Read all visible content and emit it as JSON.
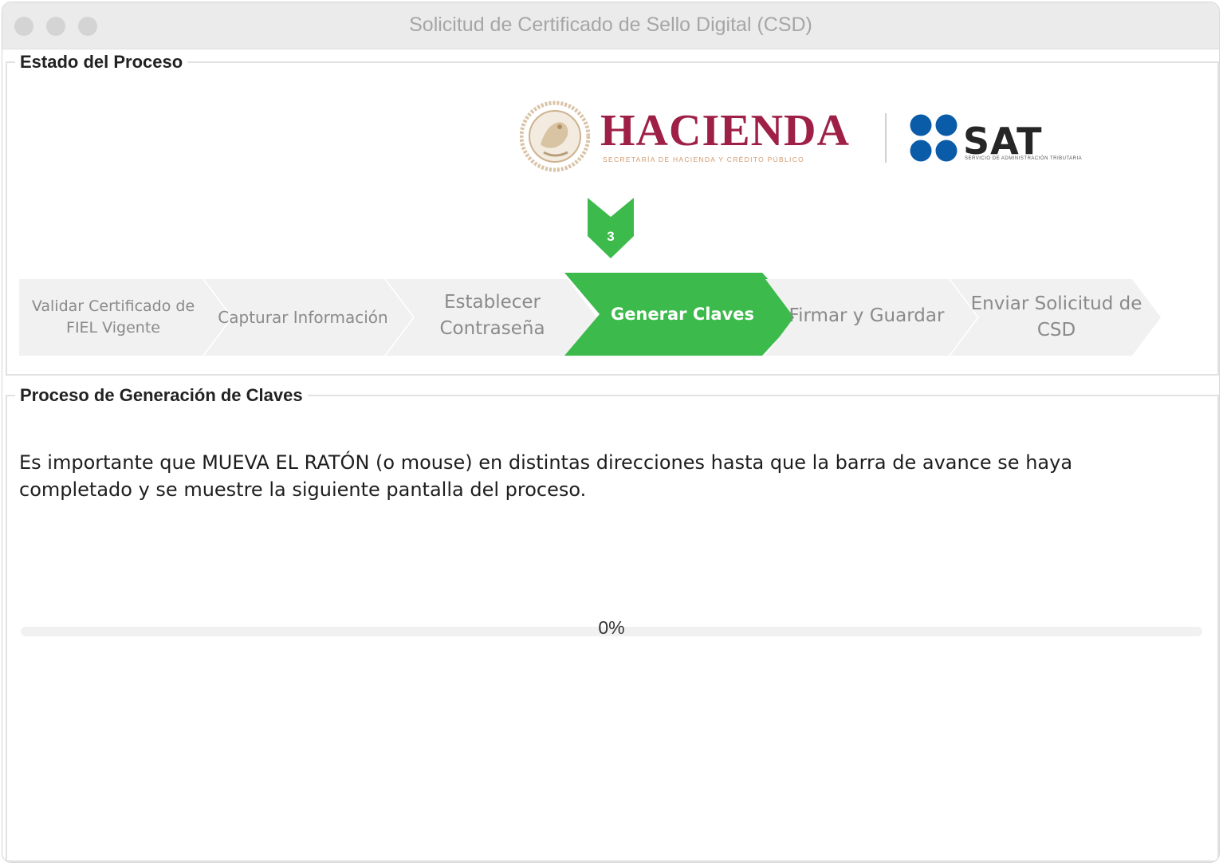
{
  "window": {
    "title": "Solicitud de Certificado de Sello Digital (CSD)"
  },
  "status_panel": {
    "legend": "Estado del Proceso",
    "logos": {
      "hacienda_name": "HACIENDA",
      "hacienda_subtitle": "SECRETARÍA DE HACIENDA Y CRÉDITO PÚBLICO",
      "sat_name": "SAT",
      "sat_subtitle": "SERVICIO DE ADMINISTRACIÓN TRIBUTARIA",
      "hacienda_color": "#9e2046",
      "sat_color": "#0a5ca8"
    },
    "current_step_number": "3",
    "steps": [
      {
        "label": "Validar Certificado de FIEL Vigente",
        "active": false
      },
      {
        "label": "Capturar Información",
        "active": false
      },
      {
        "label": "Establecer Contraseña",
        "active": false
      },
      {
        "label": "Generar Claves",
        "active": true
      },
      {
        "label": "Firmar y Guardar",
        "active": false
      },
      {
        "label": "Enviar Solicitud de CSD",
        "active": false
      }
    ],
    "colors": {
      "active_step": "#3cba4b",
      "inactive_step": "#f1f1f1"
    }
  },
  "keys_panel": {
    "legend": "Proceso de Generación de Claves",
    "instructions": "Es importante que MUEVA EL RATÓN (o mouse) en distintas direcciones hasta que la barra de avance se haya completado y se muestre la siguiente pantalla del proceso.",
    "progress": {
      "value": 0,
      "label": "0%"
    }
  }
}
